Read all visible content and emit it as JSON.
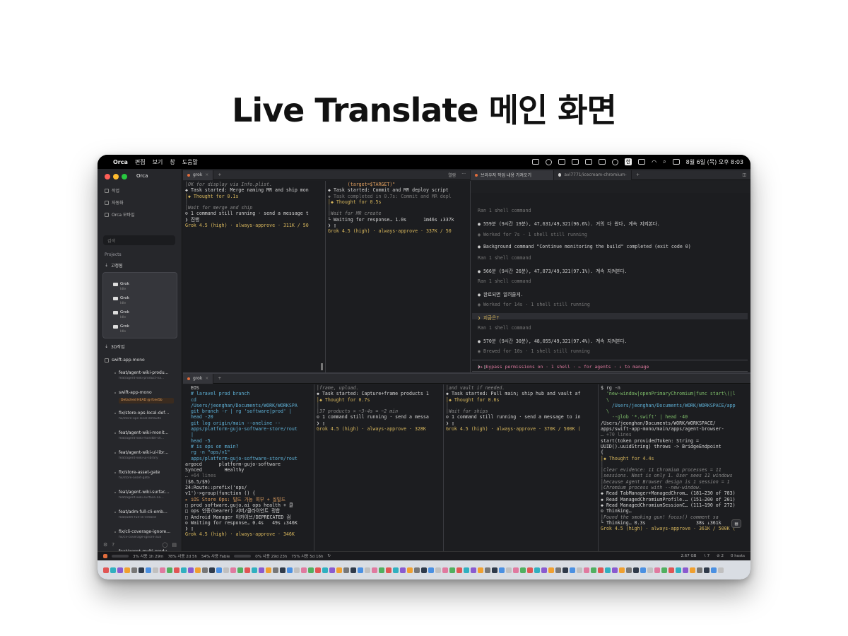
{
  "headline": "Live Translate 메인 화면",
  "menubar": {
    "app_name": "Orca",
    "menus": [
      "편집",
      "보기",
      "창",
      "도움말"
    ],
    "clock": "8월 6일 (목) 오후 8:03",
    "input_indicator": "한"
  },
  "sidebar": {
    "title": "Orca",
    "nav": [
      "작업",
      "자동화",
      "Orca 모바일"
    ],
    "search_placeholder": "검색",
    "projects_label": "Projects",
    "group_label": "고정됨",
    "agents": [
      {
        "label": "Grok",
        "sub": "Idle"
      },
      {
        "label": "Grok",
        "sub": "Idle"
      },
      {
        "label": "Grok",
        "sub": "Idle"
      },
      {
        "label": "Grok",
        "sub": "Idle"
      }
    ],
    "section_3d": "3D작업",
    "repo": "swift-app-mono",
    "worktrees": [
      {
        "name": "feat/agent-wiki-produ…",
        "branch": "feat/agent-wiki-product-na…"
      },
      {
        "name": "swift-app-mono",
        "branch": ""
      },
      {
        "name": "fix/store-ops-local-def…",
        "branch": "fix/store-ops-local-defaults"
      },
      {
        "name": "feat/agent-wiki-monit…",
        "branch": "feat/agent-wiki-monitth-sh…"
      },
      {
        "name": "feat/agent-wiki-ui-libr…",
        "branch": "feat/agent-wiki-ui-library"
      },
      {
        "name": "fix/store-asset-gate",
        "branch": "fix/store-asset-gate"
      },
      {
        "name": "feat/agent-wiki-surfac…",
        "branch": "feat/agent-wiki-surface-na…"
      },
      {
        "name": "feat/adm-full-cli-emb…",
        "branch": "feat/adm-full-cli-embed"
      },
      {
        "name": "fix/cli-coverage-ignore…",
        "branch": "fix/cli-coverage-ignore-aux"
      },
      {
        "name": "feat/agent-multi-produ…",
        "branch": ""
      }
    ],
    "detached_label": "Detached HEAD @ fcee5b"
  },
  "tabs_top_left": {
    "tab": "grok",
    "plus": "+"
  },
  "tabs_top_right": {
    "tab1": "브라우저 작업 내용 가져오기",
    "tab2": "avi7771/icecream-chromium-m…",
    "plus": "+",
    "open_label": "열람"
  },
  "tabs_bottom": {
    "tab": "grok",
    "plus": "+"
  },
  "pane_tl": [
    "│OK for display via Info.plist.",
    "◆ Task started: Merge naming MR and ship mon",
    "│◆ Thought for 0.1s",
    "│",
    "│Wait for merge and ship",
    "⊙ 1 command still running · send a message t",
    "❯ 진행",
    "Grok 4.5 (high) · always-approve · 311K / 50"
  ],
  "pane_tm": [
    "       (target=$TARGET)\"",
    "◆ Task started: Commit and MR deploy script",
    "◆ Task completed in 0.7s: Commit and MR depl",
    "│◆ Thought for 0.5s",
    "│",
    "│Wait for MR create",
    "└ Waiting for response… 1.0s      1m46s ↓337k",
    "❯ ▯",
    "Grok 4.5 (high) · always-approve · 337K / 50"
  ],
  "chat": {
    "lines": [
      "Ran 1 shell command",
      "● 559분 (9시간 19분), 47,631/49,321(96.6%). 거의 다 왔다, 계속 지켜본다.",
      "◉ Worked for 7s · 1 shell still running",
      "● Background command \"Continue monitoring the build\" completed (exit code 0)",
      "Ran 1 shell command",
      "● 566분 (9시간 26분), 47,873/49,321(97.1%). 계속 지켜본다.",
      "Ran 1 shell command",
      "● 완료되면 알려줄게.",
      "◉ Worked for 14s · 1 shell still running",
      "❯ 지금은?",
      "Ran 1 shell command",
      "● 570분 (9시간 30분), 48,055/49,321(97.4%). 계속 지켜본다.",
      "◉ Brewed for 10s · 1 shell still running"
    ],
    "prompt": "❯ ▯",
    "footer": "▸▸ bypass permissions on · 1 shell · ← for agents · ↓ to manage"
  },
  "pane_b1": [
    "  EOS",
    "",
    "  # laravel prod branch",
    "  cd",
    "  /Users/jeonghan/Documents/WORK/WORKSPA",
    "  git branch -r | rg 'software|prod' |",
    "  head -20",
    "  git log origin/main --oneline --",
    "  apps/platform-gujo-software-store/rout",
    "  |",
    "  head -5",
    "  # is ops on main?",
    "  rg -n \"ops/v1\"",
    "  apps/platform-gujo-software-store/rout",
    "",
    "argocd      platform-gujo-software",
    "Synced        Healthy",
    "… +64 lines",
    "($6.5/$9)",
    "24:Route::prefix('ops/",
    "v1')->group(function () {",
    "▸ iOS Store Ops: 빌드 가능 여부 + 실빌드",
    "□ prod software.gujo.ai ops health + 클",
    "□ ops 인증(bearer) 서버/클라이언트 정합",
    "□ Android Manager 아카이브/DEPRECATED 검",
    "⊙ Waiting for response… 0.4s   49s ↓346K",
    "❯ ▯",
    "Grok 4.5 (high) · always-approve · 346K"
  ],
  "pane_b2": [
    "│frame, upload.",
    "◆ Task started: Capture+frame products 1",
    "│◆ Thought for 0.7s",
    "│",
    "│37 products × ~3-4s = ~2 min",
    "⊙ 1 command still running · send a messa",
    "❯ ▯",
    "Grok 4.5 (high) · always-approve · 328K"
  ],
  "pane_b3": [
    "│and vault if needed.",
    "◆ Task started: Pull main; ship hub and vault af",
    "│◆ Thought for 0.6s",
    "│",
    "│Wait for ships",
    "⊙ 1 command still running · send a message to in",
    "❯ ▯",
    "Grok 4.5 (high) · always-approve · 370K / 500K ("
  ],
  "pane_b4": [
    "$ rg -n",
    "  'new-window|openPrimaryChromium|func start\\(|l",
    "  \\",
    "    /Users/jeonghan/Documents/WORK/WORKSPACE/app",
    "  \\",
    "    --glob '*.swift' | head -40",
    "",
    "/Users/jeonghan/Documents/WORK/WORKSPACE/",
    "apps/swift-app-mono/main/apps/agent-browser-",
    "… +70 lines",
    "start(token providedToken: String =",
    "UUID().uuidString) throws -> BridgeEndpoint",
    "{",
    "│◆ Thought for 4.4s",
    "│",
    "│Clear evidence: 11 Chromium processes = 11",
    "│sessions. Nest is only 1. User sees 11 windows",
    "│because Agent Browser design is 1 session = 1",
    "│Chromium process with --new-window.",
    "◆ Read TabManager+ManagedChrom… (181–230 of 783)",
    "◆ Read ManagedChromiumProfile.… (151–200 of 201)",
    "◆ Read ManagedChromiumSessionC… (111–190 of 272)",
    "⊙ Thinking…",
    "",
    "│Found the smoking gun! focus() comment sa",
    "└ Thinking… 0.3s                  38s ↓361k",
    "Grok 4.5 (high) · always-approve · 361K / 500K ("
  ],
  "statusbar": {
    "s1": "3% 사용 1h 29m",
    "s2": "78% 사용 2d 5h",
    "s3": "54% 사용 Fable",
    "s4": "0% 사용 29d 23h",
    "s5": "75% 사용 5d 16h",
    "r1": "2.67 GB",
    "r2": "⑊ 7",
    "r3": "⊘ 2",
    "r4": "0 hosts"
  },
  "colors": {
    "accent_orange": "#e0a060",
    "status_yellow": "#d7b65c",
    "link_cyan": "#5fb3d9",
    "bypass_pink": "#e07aa0"
  }
}
